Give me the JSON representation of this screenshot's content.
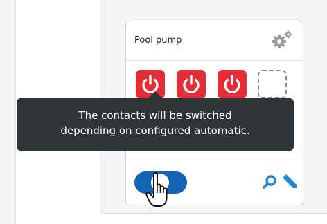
{
  "card": {
    "title": "Pool pump",
    "switches": [
      {
        "icon": "power-icon",
        "state": "on",
        "color": "#e42d36"
      },
      {
        "icon": "power-icon",
        "state": "on",
        "color": "#e42d36"
      },
      {
        "icon": "power-icon",
        "state": "on",
        "color": "#e42d36"
      },
      {
        "icon": "empty-slot",
        "state": "empty"
      }
    ],
    "toggle": {
      "color": "#1565b4"
    },
    "footer_icons": [
      "search-icon",
      "edit-icon"
    ]
  },
  "tooltip": {
    "text": "The contacts will be switched\ndepending on configured automatic."
  },
  "colors": {
    "accent": "#1565b4",
    "power": "#e42d36",
    "tooltip_bg": "#2f3537"
  }
}
